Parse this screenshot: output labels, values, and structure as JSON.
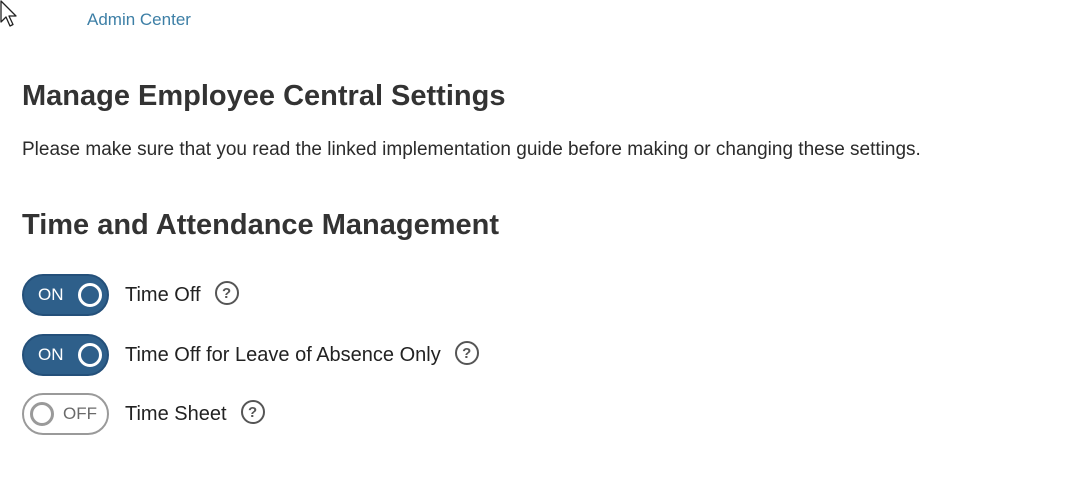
{
  "breadcrumb": {
    "label": "Admin Center"
  },
  "page": {
    "title": "Manage Employee Central Settings",
    "intro": "Please make sure that you read the linked implementation guide before making or changing these settings."
  },
  "section": {
    "title": "Time and Attendance Management",
    "settings": [
      {
        "label": "Time Off",
        "state": "ON",
        "enabled": true,
        "help_glyph": "?",
        "icon": "help-icon"
      },
      {
        "label": "Time Off for Leave of Absence Only",
        "state": "ON",
        "enabled": true,
        "help_glyph": "?",
        "icon": "help-icon"
      },
      {
        "label": "Time Sheet",
        "state": "OFF",
        "enabled": false,
        "help_glyph": "?",
        "icon": "help-icon"
      }
    ]
  },
  "colors": {
    "link": "#3d7fa6",
    "switch_on": "#2e5f8a",
    "switch_off_border": "#9a9a9a",
    "text": "#2b2b2b"
  }
}
